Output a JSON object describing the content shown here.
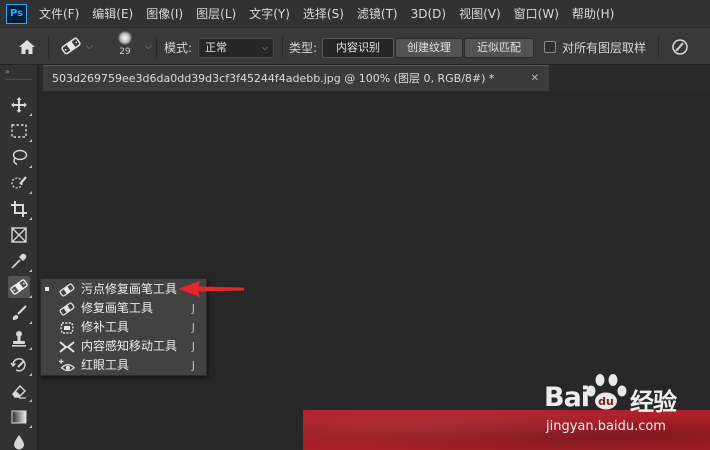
{
  "app": {
    "logo": "Ps"
  },
  "menu": [
    "文件(F)",
    "编辑(E)",
    "图像(I)",
    "图层(L)",
    "文字(Y)",
    "选择(S)",
    "滤镜(T)",
    "3D(D)",
    "视图(V)",
    "窗口(W)",
    "帮助(H)"
  ],
  "options": {
    "brush_size": "29",
    "mode_label": "模式:",
    "mode_value": "正常",
    "type_label": "类型:",
    "type_buttons": [
      "内容识别",
      "创建纹理",
      "近似匹配"
    ],
    "sample_all_label": "对所有图层取样"
  },
  "document": {
    "tab_title": "503d269759ee3d6da0dd39d3cf3f45244f4adebb.jpg @ 100% (图层 0, RGB/8#) *",
    "close_glyph": "✕"
  },
  "flyout": {
    "items": [
      {
        "label": "污点修复画笔工具",
        "key": "",
        "icon": "spot-healing-brush-icon",
        "active": true
      },
      {
        "label": "修复画笔工具",
        "key": "J",
        "icon": "healing-brush-icon",
        "active": false
      },
      {
        "label": "修补工具",
        "key": "J",
        "icon": "patch-icon",
        "active": false
      },
      {
        "label": "内容感知移动工具",
        "key": "J",
        "icon": "content-aware-move-icon",
        "active": false
      },
      {
        "label": "红眼工具",
        "key": "J",
        "icon": "red-eye-icon",
        "active": false
      }
    ]
  },
  "watermark": {
    "logo_text": "Bai经验",
    "url": "jingyan.baidu.com"
  },
  "colors": {
    "accent": "#31a8ff",
    "arrow": "#e8252b",
    "photo": "#b3222c"
  }
}
